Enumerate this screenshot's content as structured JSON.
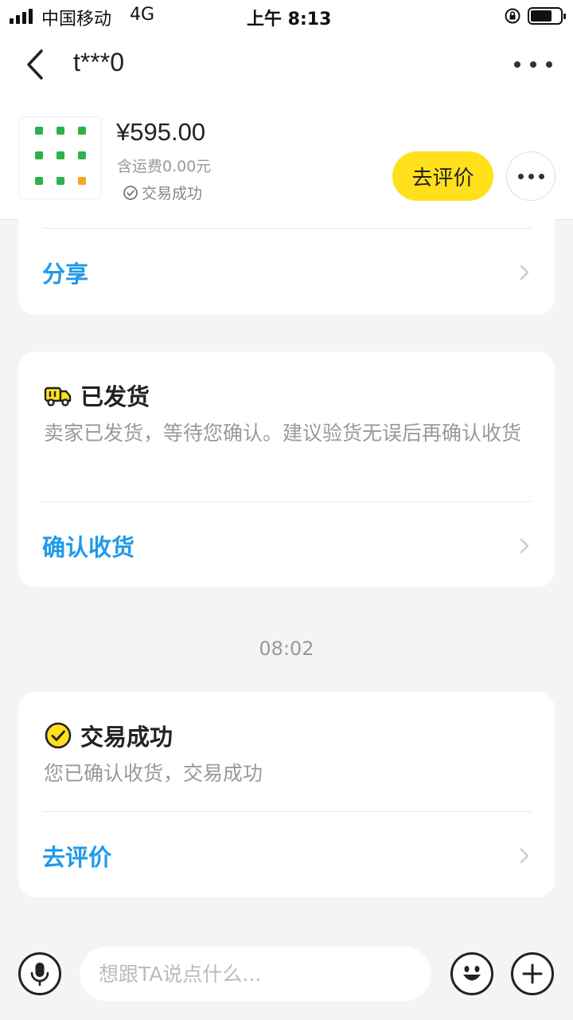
{
  "status_bar": {
    "carrier": "中国移动",
    "network": "4G",
    "time": "上午 8:13"
  },
  "nav": {
    "title": "t***0",
    "back_icon": "chevron-left-icon",
    "more_icon": "more-horizontal-icon"
  },
  "order": {
    "price": "¥595.00",
    "shipping": "含运费0.00元",
    "status": "交易成功",
    "review_button": "去评价"
  },
  "share_card": {
    "action": "分享"
  },
  "shipped_card": {
    "title": "已发货",
    "description": "卖家已发货，等待您确认。建议验货无误后再确认收货",
    "action": "确认收货"
  },
  "timestamp": "08:02",
  "success_card": {
    "title": "交易成功",
    "description": "您已确认收货，交易成功",
    "action": "去评价"
  },
  "input_bar": {
    "placeholder": "想跟TA说点什么..."
  },
  "colors": {
    "accent_blue": "#1e9ae8",
    "brand_yellow": "#ffe01b",
    "background": "#f4f4f4"
  }
}
